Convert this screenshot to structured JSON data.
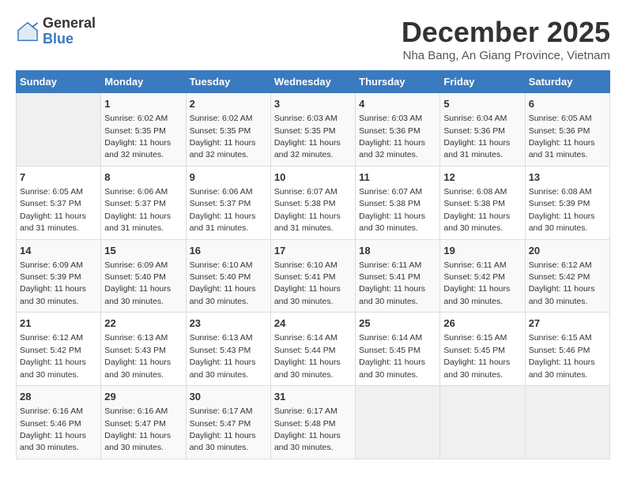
{
  "logo": {
    "general": "General",
    "blue": "Blue"
  },
  "title": {
    "month_year": "December 2025",
    "location": "Nha Bang, An Giang Province, Vietnam"
  },
  "header_days": [
    "Sunday",
    "Monday",
    "Tuesday",
    "Wednesday",
    "Thursday",
    "Friday",
    "Saturday"
  ],
  "weeks": [
    [
      {
        "day": "",
        "info": ""
      },
      {
        "day": "1",
        "info": "Sunrise: 6:02 AM\nSunset: 5:35 PM\nDaylight: 11 hours\nand 32 minutes."
      },
      {
        "day": "2",
        "info": "Sunrise: 6:02 AM\nSunset: 5:35 PM\nDaylight: 11 hours\nand 32 minutes."
      },
      {
        "day": "3",
        "info": "Sunrise: 6:03 AM\nSunset: 5:35 PM\nDaylight: 11 hours\nand 32 minutes."
      },
      {
        "day": "4",
        "info": "Sunrise: 6:03 AM\nSunset: 5:36 PM\nDaylight: 11 hours\nand 32 minutes."
      },
      {
        "day": "5",
        "info": "Sunrise: 6:04 AM\nSunset: 5:36 PM\nDaylight: 11 hours\nand 31 minutes."
      },
      {
        "day": "6",
        "info": "Sunrise: 6:05 AM\nSunset: 5:36 PM\nDaylight: 11 hours\nand 31 minutes."
      }
    ],
    [
      {
        "day": "7",
        "info": "Sunrise: 6:05 AM\nSunset: 5:37 PM\nDaylight: 11 hours\nand 31 minutes."
      },
      {
        "day": "8",
        "info": "Sunrise: 6:06 AM\nSunset: 5:37 PM\nDaylight: 11 hours\nand 31 minutes."
      },
      {
        "day": "9",
        "info": "Sunrise: 6:06 AM\nSunset: 5:37 PM\nDaylight: 11 hours\nand 31 minutes."
      },
      {
        "day": "10",
        "info": "Sunrise: 6:07 AM\nSunset: 5:38 PM\nDaylight: 11 hours\nand 31 minutes."
      },
      {
        "day": "11",
        "info": "Sunrise: 6:07 AM\nSunset: 5:38 PM\nDaylight: 11 hours\nand 30 minutes."
      },
      {
        "day": "12",
        "info": "Sunrise: 6:08 AM\nSunset: 5:38 PM\nDaylight: 11 hours\nand 30 minutes."
      },
      {
        "day": "13",
        "info": "Sunrise: 6:08 AM\nSunset: 5:39 PM\nDaylight: 11 hours\nand 30 minutes."
      }
    ],
    [
      {
        "day": "14",
        "info": "Sunrise: 6:09 AM\nSunset: 5:39 PM\nDaylight: 11 hours\nand 30 minutes."
      },
      {
        "day": "15",
        "info": "Sunrise: 6:09 AM\nSunset: 5:40 PM\nDaylight: 11 hours\nand 30 minutes."
      },
      {
        "day": "16",
        "info": "Sunrise: 6:10 AM\nSunset: 5:40 PM\nDaylight: 11 hours\nand 30 minutes."
      },
      {
        "day": "17",
        "info": "Sunrise: 6:10 AM\nSunset: 5:41 PM\nDaylight: 11 hours\nand 30 minutes."
      },
      {
        "day": "18",
        "info": "Sunrise: 6:11 AM\nSunset: 5:41 PM\nDaylight: 11 hours\nand 30 minutes."
      },
      {
        "day": "19",
        "info": "Sunrise: 6:11 AM\nSunset: 5:42 PM\nDaylight: 11 hours\nand 30 minutes."
      },
      {
        "day": "20",
        "info": "Sunrise: 6:12 AM\nSunset: 5:42 PM\nDaylight: 11 hours\nand 30 minutes."
      }
    ],
    [
      {
        "day": "21",
        "info": "Sunrise: 6:12 AM\nSunset: 5:42 PM\nDaylight: 11 hours\nand 30 minutes."
      },
      {
        "day": "22",
        "info": "Sunrise: 6:13 AM\nSunset: 5:43 PM\nDaylight: 11 hours\nand 30 minutes."
      },
      {
        "day": "23",
        "info": "Sunrise: 6:13 AM\nSunset: 5:43 PM\nDaylight: 11 hours\nand 30 minutes."
      },
      {
        "day": "24",
        "info": "Sunrise: 6:14 AM\nSunset: 5:44 PM\nDaylight: 11 hours\nand 30 minutes."
      },
      {
        "day": "25",
        "info": "Sunrise: 6:14 AM\nSunset: 5:45 PM\nDaylight: 11 hours\nand 30 minutes."
      },
      {
        "day": "26",
        "info": "Sunrise: 6:15 AM\nSunset: 5:45 PM\nDaylight: 11 hours\nand 30 minutes."
      },
      {
        "day": "27",
        "info": "Sunrise: 6:15 AM\nSunset: 5:46 PM\nDaylight: 11 hours\nand 30 minutes."
      }
    ],
    [
      {
        "day": "28",
        "info": "Sunrise: 6:16 AM\nSunset: 5:46 PM\nDaylight: 11 hours\nand 30 minutes."
      },
      {
        "day": "29",
        "info": "Sunrise: 6:16 AM\nSunset: 5:47 PM\nDaylight: 11 hours\nand 30 minutes."
      },
      {
        "day": "30",
        "info": "Sunrise: 6:17 AM\nSunset: 5:47 PM\nDaylight: 11 hours\nand 30 minutes."
      },
      {
        "day": "31",
        "info": "Sunrise: 6:17 AM\nSunset: 5:48 PM\nDaylight: 11 hours\nand 30 minutes."
      },
      {
        "day": "",
        "info": ""
      },
      {
        "day": "",
        "info": ""
      },
      {
        "day": "",
        "info": ""
      }
    ]
  ]
}
